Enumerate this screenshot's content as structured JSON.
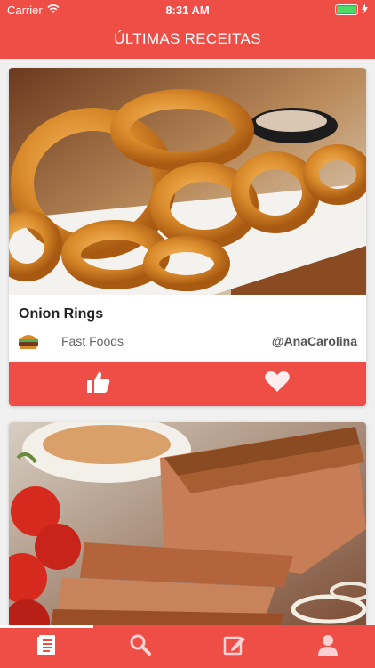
{
  "status_bar": {
    "carrier": "Carrier",
    "time": "8:31 AM"
  },
  "nav": {
    "title": "ÚLTIMAS RECEITAS"
  },
  "recipes": [
    {
      "title": "Onion Rings",
      "category": "Fast Foods",
      "category_icon": "hamburger-icon",
      "author": "@AnaCarolina"
    },
    {
      "title": "",
      "category": "",
      "author": ""
    }
  ],
  "actions": [
    "thumbs-up-icon",
    "heart-icon"
  ],
  "tabs": [
    {
      "icon": "recipes-list-icon",
      "selected": true
    },
    {
      "icon": "search-icon",
      "selected": false
    },
    {
      "icon": "edit-icon",
      "selected": false
    },
    {
      "icon": "profile-icon",
      "selected": false
    }
  ],
  "colors": {
    "primary": "#ef4e47",
    "background": "#f0f0f0",
    "battery": "#4cd964"
  }
}
